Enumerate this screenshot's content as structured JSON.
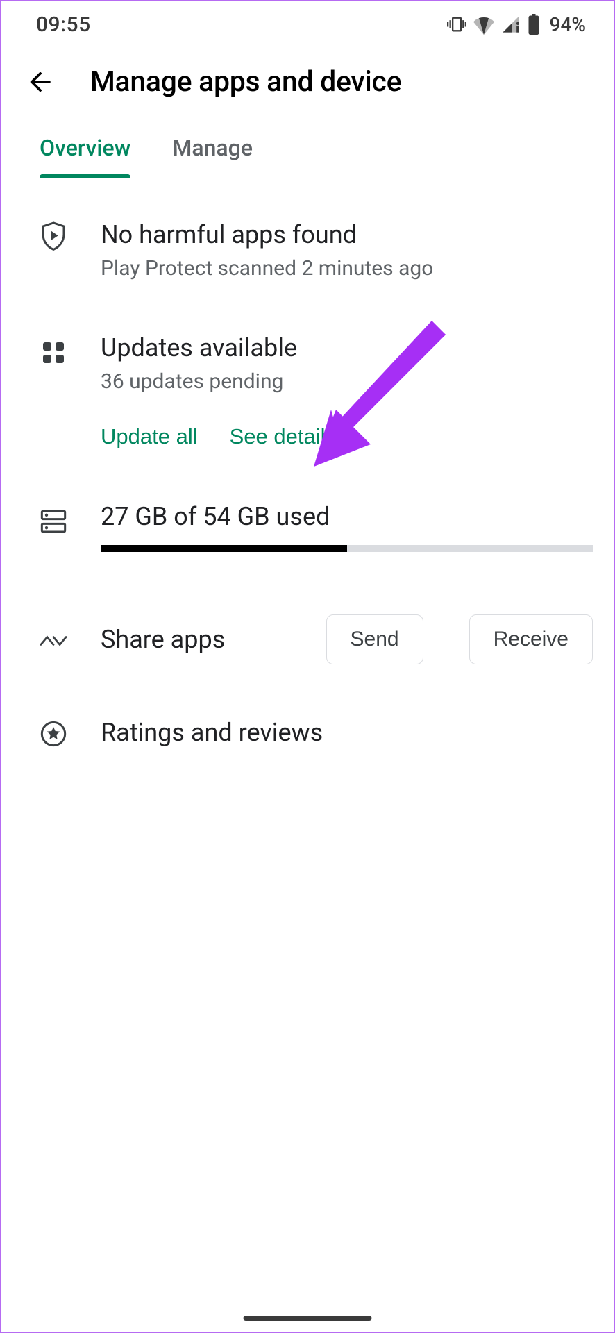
{
  "status_bar": {
    "time": "09:55",
    "battery_percent": "94%"
  },
  "header": {
    "title": "Manage apps and device"
  },
  "tabs": {
    "overview": "Overview",
    "manage": "Manage"
  },
  "protect": {
    "title": "No harmful apps found",
    "sub": "Play Protect scanned 2 minutes ago"
  },
  "updates": {
    "title": "Updates available",
    "sub": "36 updates pending",
    "update_all": "Update all",
    "see_details": "See details"
  },
  "storage": {
    "label": "27 GB of 54 GB used",
    "used": 27,
    "total": 54
  },
  "share": {
    "title": "Share apps",
    "send": "Send",
    "receive": "Receive"
  },
  "ratings": {
    "title": "Ratings and reviews"
  },
  "colors": {
    "accent": "#01875f",
    "annotation": "#a62ff5"
  }
}
